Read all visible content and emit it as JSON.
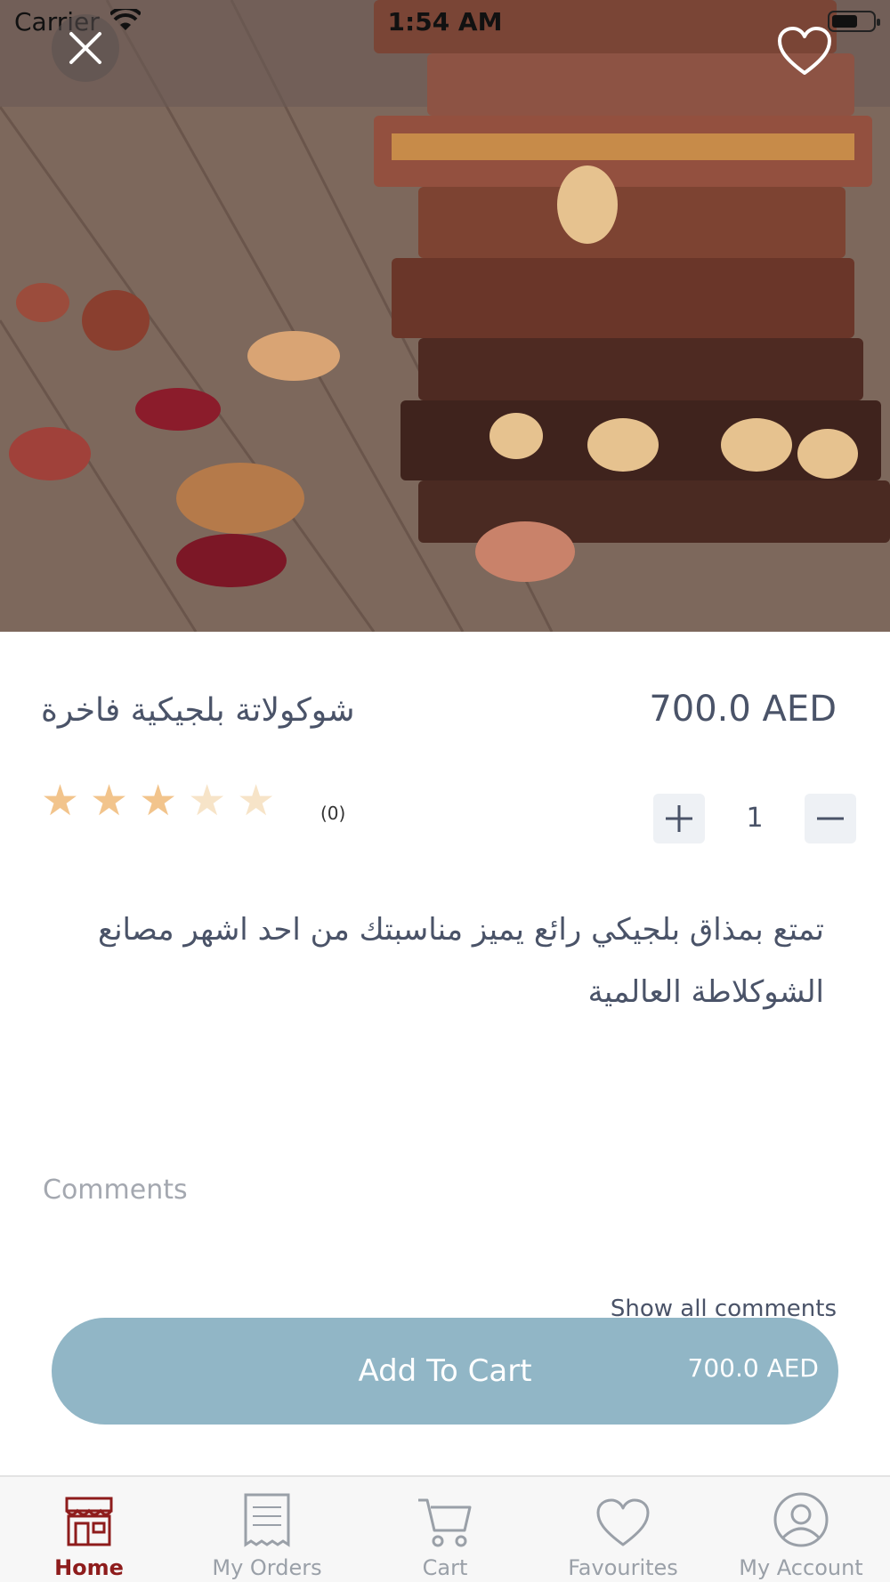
{
  "status_bar": {
    "carrier": "Carrier",
    "time": "1:54 AM"
  },
  "product": {
    "title": "شوكولاتة بلجيكية فاخرة",
    "price": "700.0 AED",
    "rating_stars_filled": 3,
    "rating_stars_total": 5,
    "rating_count": "(0)",
    "quantity": "1",
    "description": "تمتع بمذاق بلجيكي رائع يميز مناسبتك من احد اشهر مصانع الشوكلاطة العالمية"
  },
  "comments": {
    "label": "Comments",
    "show_all": "Show all comments"
  },
  "cart_button": {
    "label": "Add To Cart",
    "price": "700.0 AED"
  },
  "tabs": [
    {
      "label": "Home",
      "icon": "store-icon",
      "active": true
    },
    {
      "label": "My Orders",
      "icon": "receipt-icon",
      "active": false
    },
    {
      "label": "Cart",
      "icon": "cart-icon",
      "active": false
    },
    {
      "label": "Favourites",
      "icon": "heart-icon",
      "active": false
    },
    {
      "label": "My Account",
      "icon": "account-icon",
      "active": false
    }
  ],
  "colors": {
    "accent_active": "#8e1c1c",
    "cart_button": "#91b6c6",
    "star": "#f2c48c"
  }
}
